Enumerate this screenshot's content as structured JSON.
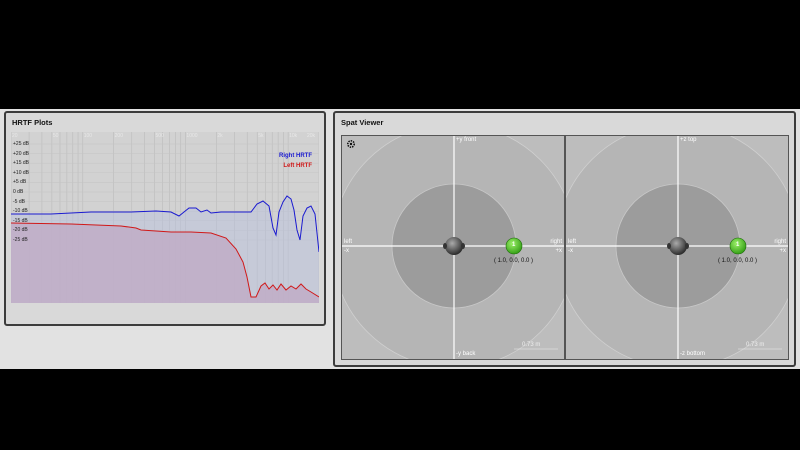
{
  "hrtf": {
    "title": "HRTF Plots",
    "legend_right": "Right HRTF",
    "legend_left": "Left HRTF",
    "colors": {
      "right": "#1a1ad0",
      "left": "#d01818"
    },
    "y_ticks": [
      "+25 dB",
      "+20 dB",
      "+15 dB",
      "+10 dB",
      "+5 dB",
      "0 dB",
      "-5 dB",
      "-10 dB",
      "-15 dB",
      "-20 dB",
      "-25 dB"
    ],
    "x_ticks": [
      "20",
      "50",
      "100",
      "200",
      "500",
      "1000",
      "2k",
      "5k",
      "10k",
      "20k"
    ]
  },
  "spat": {
    "title": "Spat Viewer",
    "settings_icon": "gear-icon",
    "top_view": {
      "up": "+y front",
      "down": "-y back",
      "left": "left",
      "left_sub": "-x",
      "right": "right",
      "right_sub": "+x",
      "source_label": "1",
      "source_coord": "( 1.0, 0.0, 0.0 )",
      "scale": "0.73 m"
    },
    "front_view": {
      "up": "+z top",
      "down": "-z bottom",
      "left": "left",
      "left_sub": "-x",
      "right": "right",
      "right_sub": "+x",
      "source_label": "1",
      "source_coord": "( 1.0, 0.0, 0.0 )",
      "scale": "0.73 m"
    }
  }
}
